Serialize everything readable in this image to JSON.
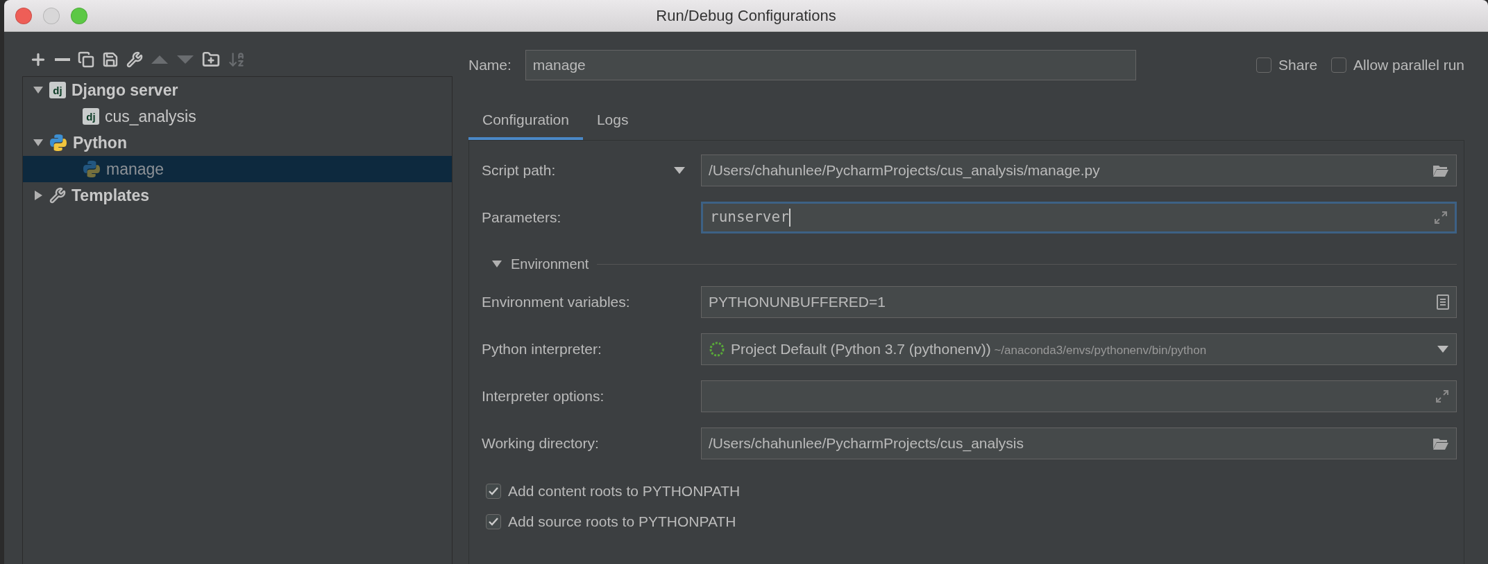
{
  "window": {
    "title": "Run/Debug Configurations"
  },
  "toolbar": [
    {
      "kind": "add",
      "disabled": false
    },
    {
      "kind": "remove",
      "disabled": false
    },
    {
      "kind": "copy",
      "disabled": false
    },
    {
      "kind": "save",
      "disabled": false
    },
    {
      "kind": "edit",
      "disabled": false
    },
    {
      "kind": "up",
      "disabled": true
    },
    {
      "kind": "down",
      "disabled": true
    },
    {
      "kind": "folder",
      "disabled": false
    },
    {
      "kind": "sort",
      "disabled": true
    }
  ],
  "tree": [
    {
      "label": "Django server",
      "kind": "django",
      "badge": "dj",
      "expanded": true,
      "selected": false,
      "children": [
        {
          "label": "cus_analysis",
          "kind": "django",
          "badge": "dj",
          "selected": false
        }
      ]
    },
    {
      "label": "Python",
      "kind": "python",
      "expanded": true,
      "selected": false,
      "children": [
        {
          "label": "manage",
          "kind": "python",
          "selected": true
        }
      ]
    },
    {
      "label": "Templates",
      "kind": "templates",
      "expanded": false,
      "selected": false
    }
  ],
  "name": {
    "label": "Name:",
    "value": "manage"
  },
  "options": [
    {
      "label": "Share",
      "checked": false
    },
    {
      "label": "Allow parallel run",
      "checked": false
    }
  ],
  "tabs": [
    {
      "label": "Configuration",
      "selected": true
    },
    {
      "label": "Logs",
      "selected": false
    }
  ],
  "fields": [
    {
      "kind": "browse",
      "label": "Script path:",
      "label_dropdown": true,
      "value": "/Users/chahunlee/PycharmProjects/cus_analysis/manage.py",
      "focused": false
    },
    {
      "kind": "expand",
      "label": "Parameters:",
      "label_dropdown": false,
      "value": "runserver",
      "focused": true
    }
  ],
  "environment": {
    "title": "Environment",
    "expanded": true,
    "fields": [
      {
        "kind": "document",
        "label": "Environment variables:",
        "value": "PYTHONUNBUFFERED=1",
        "focused": false
      },
      {
        "kind": "interpreter",
        "label": "Python interpreter:",
        "value": "Project Default (Python 3.7 (pythonenv))",
        "hint": "~/anaconda3/envs/pythonenv/bin/python",
        "focused": false
      },
      {
        "kind": "expand",
        "label": "Interpreter options:",
        "focused": false
      },
      {
        "kind": "browse",
        "label": "Working directory:",
        "value": "/Users/chahunlee/PycharmProjects/cus_analysis",
        "focused": false
      }
    ]
  },
  "checkboxes": [
    {
      "label": "Add content roots to PYTHONPATH",
      "checked": true
    },
    {
      "label": "Add source roots to PYTHONPATH",
      "checked": true
    }
  ]
}
